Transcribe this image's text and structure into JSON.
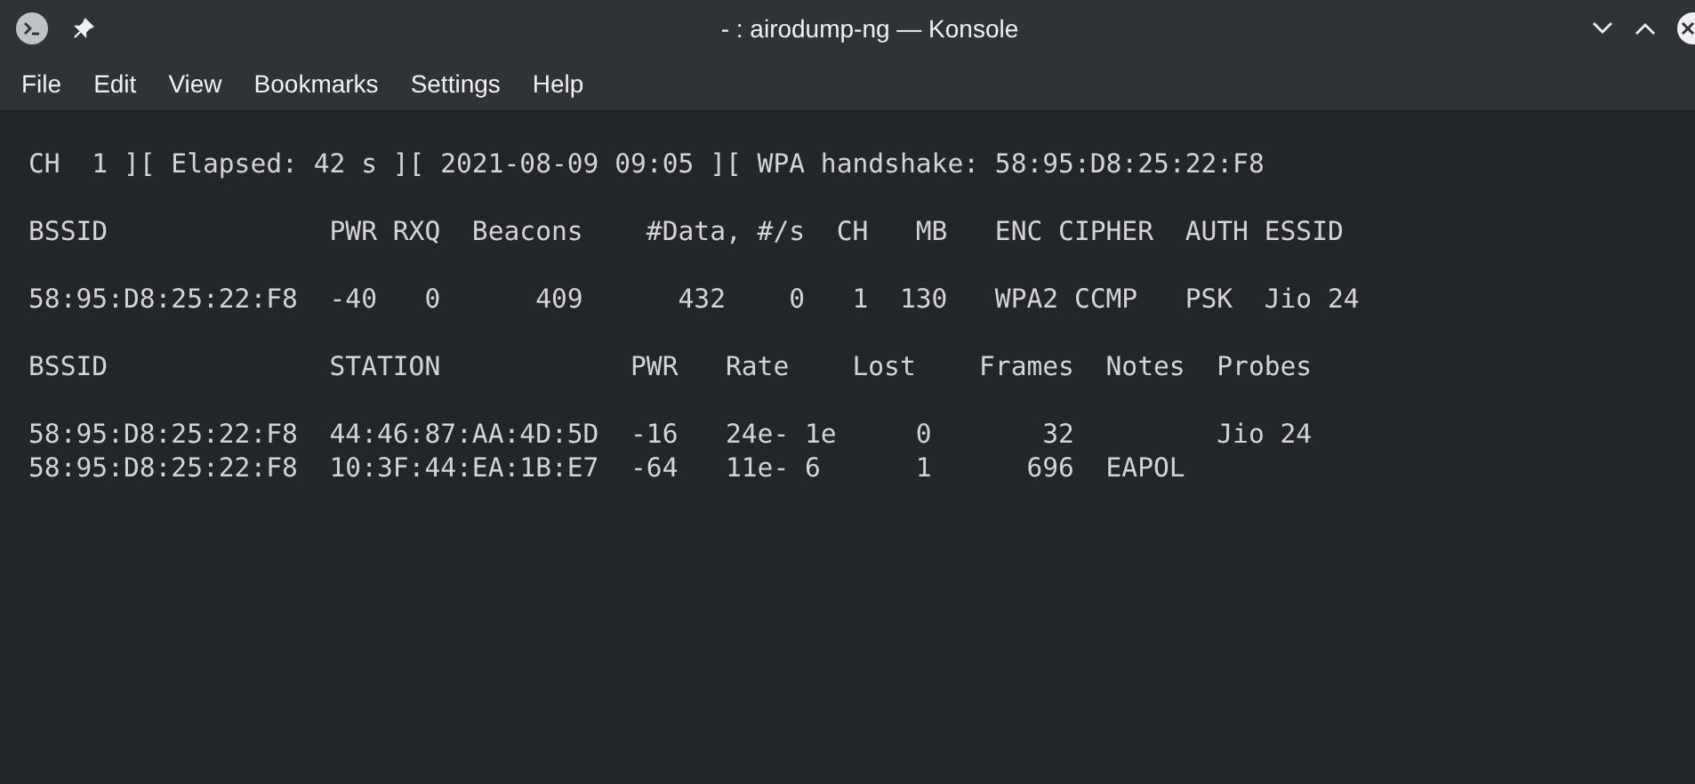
{
  "window": {
    "title": "- : airodump-ng — Konsole"
  },
  "menu": [
    "File",
    "Edit",
    "View",
    "Bookmarks",
    "Settings",
    "Help"
  ],
  "terminal": {
    "status_line": "CH  1 ][ Elapsed: 42 s ][ 2021-08-09 09:05 ][ WPA handshake: 58:95:D8:25:22:F8",
    "ap_table": {
      "header": "BSSID              PWR RXQ  Beacons    #Data, #/s  CH   MB   ENC CIPHER  AUTH ESSID",
      "rows": [
        "58:95:D8:25:22:F8  -40   0      409      432    0   1  130   WPA2 CCMP   PSK  Jio 24"
      ]
    },
    "station_table": {
      "header": "BSSID              STATION            PWR   Rate    Lost    Frames  Notes  Probes",
      "rows": [
        "58:95:D8:25:22:F8  44:46:87:AA:4D:5D  -16   24e- 1e     0       32         Jio 24",
        "58:95:D8:25:22:F8  10:3F:44:EA:1B:E7  -64   11e- 6      1      696  EAPOL"
      ]
    }
  }
}
